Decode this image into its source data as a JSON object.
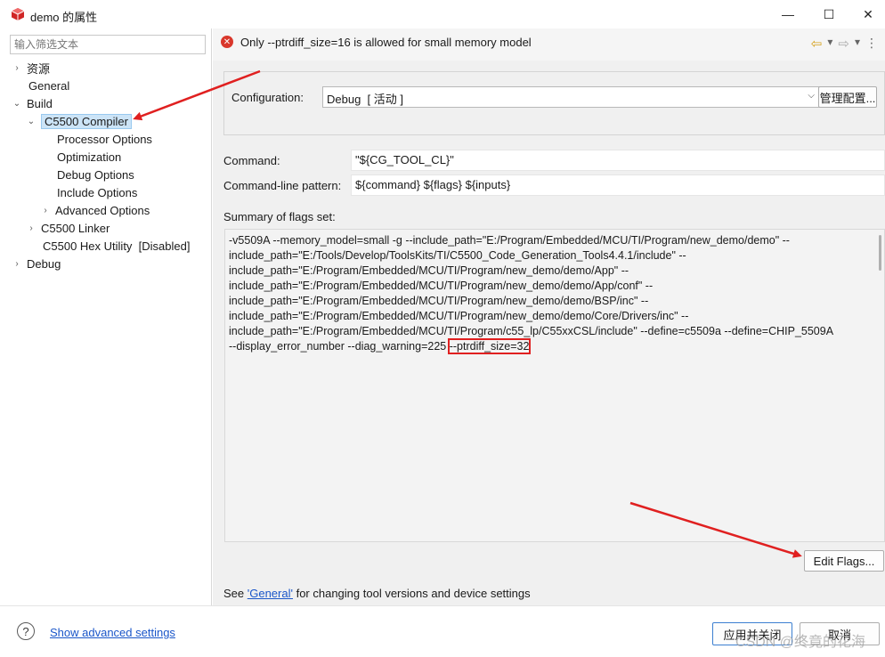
{
  "window": {
    "title": "demo 的属性",
    "minimize_glyph": "—",
    "maximize_glyph": "☐",
    "close_glyph": "✕"
  },
  "filter": {
    "placeholder": "输入筛选文本"
  },
  "tree": {
    "resources": "资源",
    "general": "General",
    "build": "Build",
    "compiler": "C5500 Compiler",
    "processor_options": "Processor Options",
    "optimization": "Optimization",
    "debug_options": "Debug Options",
    "include_options": "Include Options",
    "advanced_options": "Advanced Options",
    "linker": "C5500 Linker",
    "hex_utility": "C5500 Hex Utility  [Disabled]",
    "debug": "Debug"
  },
  "message": {
    "icon": "error-icon",
    "text": "Only --ptrdiff_size=16 is allowed for small memory model"
  },
  "configuration": {
    "label": "Configuration:",
    "value": "Debug  [ 活动 ]",
    "manage_button": "管理配置..."
  },
  "command": {
    "label": "Command:",
    "value": "\"${CG_TOOL_CL}\""
  },
  "pattern": {
    "label": "Command-line pattern:",
    "value": "${command} ${flags} ${inputs}"
  },
  "summary": {
    "label": "Summary of flags set:",
    "lines": [
      "-v5509A --memory_model=small -g --include_path=\"E:/Program/Embedded/MCU/TI/Program/new_demo/demo\" --",
      "include_path=\"E:/Tools/Develop/ToolsKits/TI/C5500_Code_Generation_Tools4.4.1/include\" --",
      "include_path=\"E:/Program/Embedded/MCU/TI/Program/new_demo/demo/App\" --",
      "include_path=\"E:/Program/Embedded/MCU/TI/Program/new_demo/demo/App/conf\" --",
      "include_path=\"E:/Program/Embedded/MCU/TI/Program/new_demo/demo/BSP/inc\" --",
      "include_path=\"E:/Program/Embedded/MCU/TI/Program/new_demo/demo/Core/Drivers/inc\" --",
      "include_path=\"E:/Program/Embedded/MCU/TI/Program/c55_lp/C55xxCSL/include\" --define=c5509a --define=CHIP_5509A"
    ],
    "last_line_start": "--display_error_number --diag_warning=225 ",
    "highlighted_flag": "--ptrdiff_size=32"
  },
  "edit_flags_button": "Edit Flags...",
  "footer_note": {
    "prefix": "See ",
    "link": "'General'",
    "suffix": " for changing tool versions and device settings"
  },
  "bottom": {
    "help_glyph": "?",
    "advanced_link": "Show advanced settings",
    "apply_close_button": "应用并关闭",
    "cancel_button": "取消",
    "watermark": "CSDN @终竟的花海"
  },
  "colors": {
    "accent": "#1a56c9",
    "error": "#d9372b",
    "annotation": "#e02020",
    "selection": "#cce4f7"
  }
}
